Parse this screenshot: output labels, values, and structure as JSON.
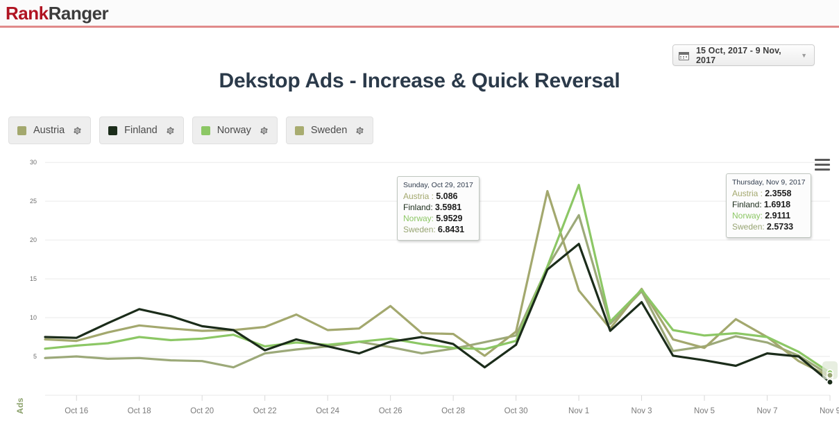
{
  "header": {
    "logo_first": "Rank",
    "logo_second": "Ranger"
  },
  "datepicker": {
    "value": "15 Oct, 2017 - 9 Nov, 2017",
    "icon": "calendar-icon",
    "caret": "▼"
  },
  "title": "Dekstop Ads - Increase & Quick Reversal",
  "legend": {
    "items": [
      {
        "label": "Austria",
        "color": "#a3a86e",
        "gear": "gear-icon"
      },
      {
        "label": "Finland",
        "color": "#1b2c1a",
        "gear": "gear-icon"
      },
      {
        "label": "Norway",
        "color": "#8cc765",
        "gear": "gear-icon"
      },
      {
        "label": "Sweden",
        "color": "#a8ac70",
        "gear": "gear-icon"
      }
    ]
  },
  "menu": {
    "icon": "hamburger-menu-icon"
  },
  "tooltips": [
    {
      "id": "oct29",
      "date": "Sunday, Oct 29, 2017",
      "rows": [
        {
          "name": "Austria :",
          "value": "5.086",
          "color": "#a3a86e"
        },
        {
          "name": "Finland:",
          "value": "3.5981",
          "color": "#1b2c1a"
        },
        {
          "name": "Norway:",
          "value": "5.9529",
          "color": "#8cc765"
        },
        {
          "name": "Sweden:",
          "value": "6.8431",
          "color": "#97a472"
        }
      ]
    },
    {
      "id": "nov9",
      "date": "Thursday, Nov 9, 2017",
      "rows": [
        {
          "name": "Austria :",
          "value": "2.3558",
          "color": "#a3a86e"
        },
        {
          "name": "Finland:",
          "value": "1.6918",
          "color": "#1b2c1a"
        },
        {
          "name": "Norway:",
          "value": "2.9111",
          "color": "#8cc765"
        },
        {
          "name": "Sweden:",
          "value": "2.5733",
          "color": "#97a472"
        }
      ]
    }
  ],
  "chart_data": {
    "type": "line",
    "title": "Dekstop Ads - Increase & Quick Reversal",
    "xlabel": "",
    "ylabel": "Ads",
    "ylim": [
      0,
      31
    ],
    "yticks": [
      5,
      10,
      15,
      20,
      25,
      30
    ],
    "grid": true,
    "legend_position": "top-left",
    "x": [
      "Oct 15",
      "Oct 16",
      "Oct 17",
      "Oct 18",
      "Oct 19",
      "Oct 20",
      "Oct 21",
      "Oct 22",
      "Oct 23",
      "Oct 24",
      "Oct 25",
      "Oct 26",
      "Oct 27",
      "Oct 28",
      "Oct 29",
      "Oct 30",
      "Oct 31",
      "Nov 1",
      "Nov 2",
      "Nov 3",
      "Nov 4",
      "Nov 5",
      "Nov 6",
      "Nov 7",
      "Nov 8",
      "Nov 9"
    ],
    "xtick_labels": [
      "Oct 16",
      "Oct 18",
      "Oct 20",
      "Oct 22",
      "Oct 24",
      "Oct 26",
      "Oct 28",
      "Oct 30",
      "Nov 1",
      "Nov 3",
      "Nov 5",
      "Nov 7",
      "Nov 9"
    ],
    "series": [
      {
        "name": "Austria",
        "color": "#a3a86e",
        "values": [
          7.2,
          7.0,
          8.1,
          9.0,
          8.6,
          8.3,
          8.4,
          8.8,
          10.4,
          8.4,
          8.6,
          11.5,
          8.0,
          7.9,
          5.086,
          8.2,
          26.3,
          13.5,
          8.6,
          13.7,
          7.2,
          6.1,
          9.8,
          7.5,
          4.4,
          2.3558
        ]
      },
      {
        "name": "Finland",
        "color": "#1b2c1a",
        "values": [
          7.5,
          7.4,
          9.3,
          11.1,
          10.2,
          8.9,
          8.4,
          5.8,
          7.2,
          6.3,
          5.4,
          6.9,
          7.5,
          6.6,
          3.5981,
          6.5,
          16.2,
          19.5,
          8.3,
          12.0,
          5.1,
          4.5,
          3.8,
          5.4,
          5.0,
          1.6918
        ]
      },
      {
        "name": "Norway",
        "color": "#8cc765",
        "values": [
          6.0,
          6.4,
          6.7,
          7.5,
          7.1,
          7.3,
          7.8,
          6.3,
          6.8,
          6.5,
          6.9,
          7.3,
          6.6,
          6.1,
          5.9529,
          7.0,
          16.6,
          27.1,
          9.5,
          13.6,
          8.4,
          7.7,
          8.0,
          7.5,
          5.6,
          2.9111
        ]
      },
      {
        "name": "Sweden",
        "color": "#97a472",
        "values": [
          4.8,
          5.0,
          4.7,
          4.8,
          4.5,
          4.4,
          3.6,
          5.4,
          5.9,
          6.3,
          6.9,
          6.2,
          5.4,
          6.0,
          6.8431,
          7.7,
          16.5,
          23.2,
          9.2,
          13.4,
          5.7,
          6.3,
          7.6,
          6.8,
          5.1,
          2.5733
        ]
      }
    ]
  }
}
